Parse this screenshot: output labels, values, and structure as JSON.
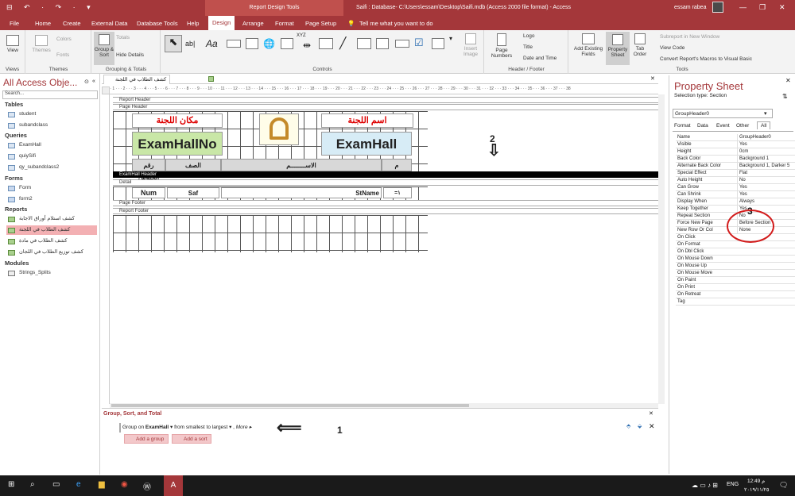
{
  "titlebar": {
    "qat": "⊟ ↶ · ↷ · ▾",
    "tools_tab": "Report Design Tools",
    "doc_title": "Saifi : Database- C:\\Users\\essam\\Desktop\\Saifi.mdb (Access 2000 file format) - Access",
    "user": "essam rabea"
  },
  "menu": [
    "File",
    "Home",
    "Create",
    "External Data",
    "Database Tools",
    "Help",
    "Design",
    "Arrange",
    "Format",
    "Page Setup"
  ],
  "tellme": "Tell me what you want to do",
  "ribbon": {
    "views": "View",
    "views_group": "Views",
    "themes": "Themes",
    "colors": "Colors",
    "fonts": "Fonts",
    "themes_group": "Themes",
    "group_sort": "Group & Sort",
    "totals": "Totals",
    "hide_details": "Hide Details",
    "grouping_group": "Grouping & Totals",
    "controls_group": "Controls",
    "insert_image": "Insert Image",
    "page_numbers": "Page Numbers",
    "logo": "Logo",
    "title": "Title",
    "date_time": "Date and Time",
    "hf_group": "Header / Footer",
    "add_fields": "Add Existing Fields",
    "property_sheet": "Property Sheet",
    "tab_order": "Tab Order",
    "subreport": "Subreport in New Window",
    "view_code": "View Code",
    "convert_macros": "Convert Report's Macros to Visual Basic",
    "tools_group": "Tools"
  },
  "nav": {
    "header": "All Access Obje...",
    "search": "Search...",
    "tables_title": "Tables",
    "tables": [
      "student",
      "subandclass"
    ],
    "queries_title": "Queries",
    "queries": [
      "ExamHall",
      "quiySifi",
      "qy_subandclass2"
    ],
    "forms_title": "Forms",
    "forms": [
      "Form",
      "form2"
    ],
    "reports_title": "Reports",
    "reports": [
      "كشف استلام أوراق الاجابة",
      "كشف الطلاب في اللجنة",
      "كشف الطلاب في مادة",
      "كشف توزيع الطلاب في اللجان"
    ],
    "modules_title": "Modules",
    "modules": [
      "Strings_Splits"
    ]
  },
  "doctab": "كشف الطلاب في اللجنة",
  "ruler": "1 · · · 1 · · · 2 · · · 3 · · · 4 · · · 5 · · · 6 · · · 7 · · · 8 · · · 9 · · · 10 · · · 11 · · · 12 · · · 13 · · · 14 · · · 15 · · · 16 · · · 17 · · · 18 · · · 19 · · · 20 · · · 21 · · · 22 · · · 23 · · · 24 · · · 25 · · · 26 · · · 27 · · · 28 · · · 29 · · · 30 · · · 31 · · · 32 · · · 33 · · · 34 · · · 35 · · · 36 · · · 37 · · · 38",
  "sections": {
    "report_header": "Report Header",
    "page_header": "Page Header",
    "examhall_header": "ExamHall Header",
    "detail": "Detail",
    "page_footer": "Page Footer",
    "report_footer": "Report Footer"
  },
  "design": {
    "lbl_place": "مكان اللجنة",
    "lbl_name": "اسم اللجنة",
    "examhallno": "ExamHallNo",
    "examhall": "ExamHall",
    "seat": "رقم الجلوس",
    "class": "الصف",
    "student_name": "الاســــــــم",
    "m": "م",
    "num": "Num",
    "saf": "Saf",
    "stname": "StName",
    "counter": "=١"
  },
  "annotations": {
    "a1": "1",
    "a2": "2",
    "a3": "3"
  },
  "propsheet": {
    "title": "Property Sheet",
    "sel_type_label": "Selection type:",
    "sel_type": "Section",
    "selected": "GroupHeader0",
    "tabs": [
      "Format",
      "Data",
      "Event",
      "Other",
      "All"
    ],
    "rows": [
      [
        "Name",
        "GroupHeader0"
      ],
      [
        "Visible",
        "Yes"
      ],
      [
        "Height",
        "0cm"
      ],
      [
        "Back Color",
        "Background 1"
      ],
      [
        "Alternate Back Color",
        "Background 1, Darker 5"
      ],
      [
        "Special Effect",
        "Flat"
      ],
      [
        "Auto Height",
        "No"
      ],
      [
        "Can Grow",
        "Yes"
      ],
      [
        "Can Shrink",
        "Yes"
      ],
      [
        "Display When",
        "Always"
      ],
      [
        "Keep Together",
        "Yes"
      ],
      [
        "Repeat Section",
        "No"
      ],
      [
        "Force New Page",
        "Before Section"
      ],
      [
        "New Row Or Col",
        "None"
      ],
      [
        "On Click",
        ""
      ],
      [
        "On Format",
        ""
      ],
      [
        "On Dbl Click",
        ""
      ],
      [
        "On Mouse Down",
        ""
      ],
      [
        "On Mouse Up",
        ""
      ],
      [
        "On Mouse Move",
        ""
      ],
      [
        "On Paint",
        ""
      ],
      [
        "On Print",
        ""
      ],
      [
        "On Retreat",
        ""
      ],
      [
        "Tag",
        ""
      ]
    ]
  },
  "gst": {
    "title": "Group, Sort, and Total",
    "group_on": "Group on",
    "field": "ExamHall",
    "order": "from smallest to largest",
    "more": "More ▸",
    "add_group": "Add a group",
    "add_sort": "Add a sort"
  },
  "taskbar": {
    "lang": "ENG",
    "time": "12:49 م",
    "date": "٢٠١٩/١١/٢٥"
  }
}
